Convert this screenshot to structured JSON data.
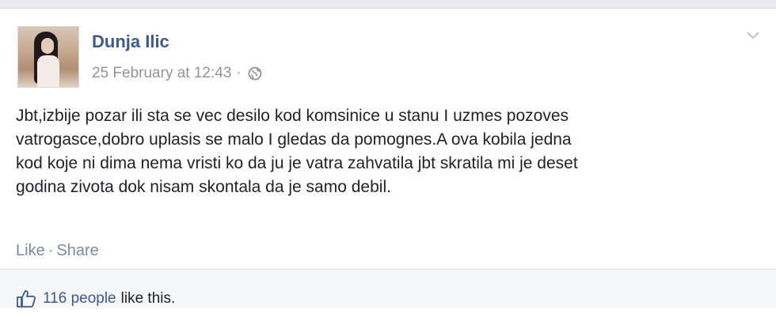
{
  "post": {
    "author": "Dunja Ilic",
    "timestamp": "25 February at 12:43",
    "separator": "·",
    "privacy_icon": "globe-icon",
    "options_icon": "chevron-down-icon",
    "text_lines": [
      "Jbt,izbije pozar ili sta se vec desilo kod komsinice u stanu I uzmes pozoves",
      "vatrogasce,dobro uplasis se malo I gledas da pomognes.A ova kobila jedna",
      "kod koje ni dima nema vristi ko da ju je vatra zahvatila jbt skratila mi je deset",
      "godina zivota dok nisam skontala da je samo debil."
    ]
  },
  "actions": {
    "like_label": "Like",
    "dot": "·",
    "share_label": "Share"
  },
  "likes": {
    "icon": "thumbs-up-icon",
    "count_label": "116 people",
    "suffix": "like this."
  }
}
